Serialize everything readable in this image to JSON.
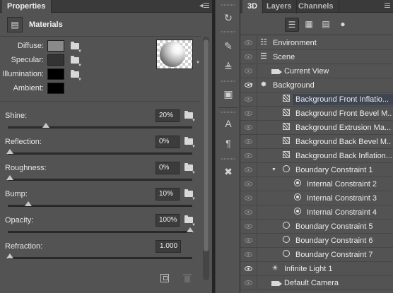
{
  "properties_panel": {
    "tab_title": "Properties",
    "close_glyph": "×",
    "menu_icon": "panel-menu-icon",
    "header": {
      "icon": "materials-icon",
      "title": "Materials"
    },
    "material_rows": [
      {
        "label": "Diffuse:",
        "swatch_color": "#8a8a8a",
        "icon": "texture-folder-icon"
      },
      {
        "label": "Specular:",
        "swatch_color": "#333333",
        "icon": "texture-folder-icon"
      },
      {
        "label": "Illumination:",
        "swatch_color": "#000000",
        "icon": "texture-folder-icon"
      },
      {
        "label": "Ambient:",
        "swatch_color": "#000000",
        "icon": null
      }
    ],
    "preview_icon": "material-sphere-preview",
    "sliders": [
      {
        "label": "Shine:",
        "value": "20%",
        "level": 0.2
      },
      {
        "label": "Reflection:",
        "value": "0%",
        "level": 0.0
      },
      {
        "label": "Roughness:",
        "value": "0%",
        "level": 0.0
      },
      {
        "label": "Bump:",
        "value": "10%",
        "level": 0.1
      },
      {
        "label": "Opacity:",
        "value": "100%",
        "level": 1.0
      },
      {
        "label": "Refraction:",
        "value": "1.000",
        "level": 0.0
      }
    ],
    "footer_icons": [
      "apply-icon",
      "trash-icon"
    ]
  },
  "tool_dock": {
    "icons": [
      "3d-tool-icon",
      "brush-preset-icon",
      "brush-settings-icon",
      "stamp-icon",
      "character-icon",
      "paragraph-icon",
      "tools-icon"
    ]
  },
  "panel_3d": {
    "tabs": [
      {
        "label": "3D",
        "active": true
      },
      {
        "label": "Layers",
        "active": false
      },
      {
        "label": "Channels",
        "active": false
      }
    ],
    "filters": [
      "whole-scene-icon",
      "meshes-icon",
      "materials-filter-icon",
      "lights-icon"
    ],
    "nodes": [
      {
        "label": "Environment",
        "icon": "environment-icon",
        "depth": 0,
        "twist": "",
        "eye": "dim",
        "selected": false
      },
      {
        "label": "Scene",
        "icon": "scene-icon",
        "depth": 0,
        "twist": "",
        "eye": "dim",
        "selected": false
      },
      {
        "label": "Current View",
        "icon": "camera-icon",
        "depth": 1,
        "twist": "",
        "eye": "dim",
        "selected": false
      },
      {
        "label": "Background",
        "icon": "mesh-3d-icon",
        "depth": 0,
        "twist": "▼",
        "eye": "on",
        "selected": false
      },
      {
        "label": "Background Front Inflatio...",
        "icon": "material-icon",
        "depth": 2,
        "twist": "",
        "eye": "dim",
        "selected": true
      },
      {
        "label": "Background Front Bevel M...",
        "icon": "material-icon",
        "depth": 2,
        "twist": "",
        "eye": "dim",
        "selected": false
      },
      {
        "label": "Background Extrusion Ma...",
        "icon": "material-icon",
        "depth": 2,
        "twist": "",
        "eye": "dim",
        "selected": false
      },
      {
        "label": "Background Back Bevel M...",
        "icon": "material-icon",
        "depth": 2,
        "twist": "",
        "eye": "dim",
        "selected": false
      },
      {
        "label": "Background Back Inflation...",
        "icon": "material-icon",
        "depth": 2,
        "twist": "",
        "eye": "dim",
        "selected": false
      },
      {
        "label": "Boundary Constraint 1",
        "icon": "constraint-icon",
        "depth": 2,
        "twist": "▼",
        "eye": "dim",
        "selected": false
      },
      {
        "label": "Internal Constraint 2",
        "icon": "internal-constraint-icon",
        "depth": 3,
        "twist": "",
        "eye": "dim",
        "selected": false
      },
      {
        "label": "Internal Constraint 3",
        "icon": "internal-constraint-icon",
        "depth": 3,
        "twist": "",
        "eye": "dim",
        "selected": false
      },
      {
        "label": "Internal Constraint 4",
        "icon": "internal-constraint-icon",
        "depth": 3,
        "twist": "",
        "eye": "dim",
        "selected": false
      },
      {
        "label": "Boundary Constraint 5",
        "icon": "constraint-icon",
        "depth": 2,
        "twist": "",
        "eye": "dim",
        "selected": false
      },
      {
        "label": "Boundary Constraint 6",
        "icon": "constraint-icon",
        "depth": 2,
        "twist": "",
        "eye": "dim",
        "selected": false
      },
      {
        "label": "Boundary Constraint 7",
        "icon": "constraint-icon",
        "depth": 2,
        "twist": "",
        "eye": "dim",
        "selected": false
      },
      {
        "label": "Infinite Light 1",
        "icon": "light-icon",
        "depth": 1,
        "twist": "",
        "eye": "on",
        "selected": false
      },
      {
        "label": "Default Camera",
        "icon": "camera-icon",
        "depth": 1,
        "twist": "",
        "eye": "dim",
        "selected": false
      }
    ]
  }
}
